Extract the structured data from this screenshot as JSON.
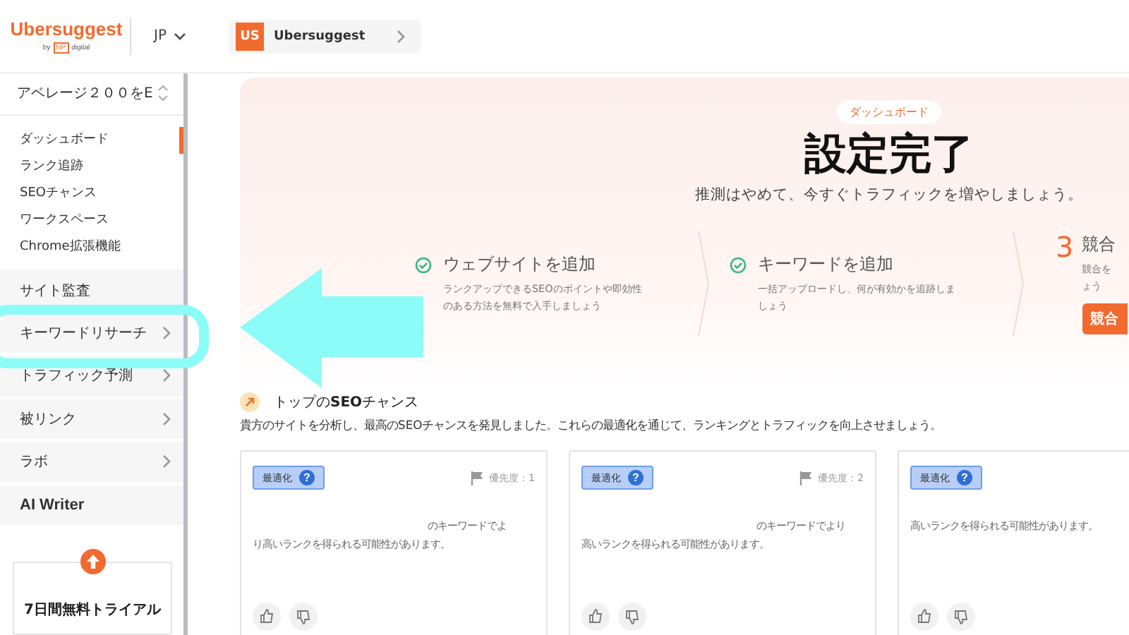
{
  "header": {
    "logo": "Ubersuggest",
    "logo_byline_prefix": "by",
    "logo_byline_mark": "NP",
    "logo_byline_suffix": "digital",
    "language": "JP",
    "project": {
      "initials": "US",
      "name": "Ubersuggest"
    }
  },
  "sidebar": {
    "site_select": "アベレージ２００をE",
    "subitems": [
      {
        "label": "ダッシュボード",
        "selected": true
      },
      {
        "label": "ランク追跡",
        "selected": false
      },
      {
        "label": "SEOチャンス",
        "selected": false
      },
      {
        "label": "ワークスペース",
        "selected": false
      },
      {
        "label": "Chrome拡張機能",
        "selected": false
      }
    ],
    "sections": [
      {
        "label": "サイト監査",
        "expandable": false,
        "highlighted": false,
        "bold": false
      },
      {
        "label": "キーワードリサーチ",
        "expandable": true,
        "highlighted": true,
        "bold": false
      },
      {
        "label": "トラフィック予測",
        "expandable": true,
        "highlighted": false,
        "bold": false
      },
      {
        "label": "被リンク",
        "expandable": true,
        "highlighted": false,
        "bold": false
      },
      {
        "label": "ラボ",
        "expandable": true,
        "highlighted": false,
        "bold": false
      },
      {
        "label": "AI Writer",
        "expandable": false,
        "highlighted": false,
        "bold": true
      }
    ],
    "trial": {
      "label": "7日間無料トライアル"
    }
  },
  "hero": {
    "badge": "ダッシュボード",
    "title": "設定完了",
    "subtitle": "推測はやめて、今すぐトラフィックを増やしましょう。",
    "steps": [
      {
        "kind": "done",
        "title": "ウェブサイトを追加",
        "description": [
          "ランクアップできるSEOのポイントや即効性",
          "のある方法を無料で入手しましょう"
        ]
      },
      {
        "kind": "done",
        "title": "キーワードを追加",
        "description": [
          "一括アップロードし、何が有効かを追跡しま",
          "しょう"
        ]
      },
      {
        "kind": "numbered",
        "number": "3",
        "title": "競合",
        "description": [
          "競合を",
          "ょう"
        ],
        "button": "競合"
      }
    ]
  },
  "opportunities": {
    "title": "トップの**SEO**チャンス",
    "description": "貴方のサイトを分析し、最高のSEOチャンスを発見しました。これらの最適化を通じて、ランキングとトラフィックを向上させましょう。",
    "cards": [
      {
        "tag": "最適化",
        "tag_help": "?",
        "priority": "優先度：1",
        "lines": [
          "のキーワードでよ",
          "り高いランクを得られる可能性があります。"
        ]
      },
      {
        "tag": "最適化",
        "tag_help": "?",
        "priority": "優先度：2",
        "lines": [
          "のキーワードでより",
          "高いランクを得られる可能性があります。"
        ]
      },
      {
        "tag": "最適化",
        "tag_help": "?",
        "lines": [
          "高いランクを得られる可能性があります。"
        ]
      }
    ]
  }
}
